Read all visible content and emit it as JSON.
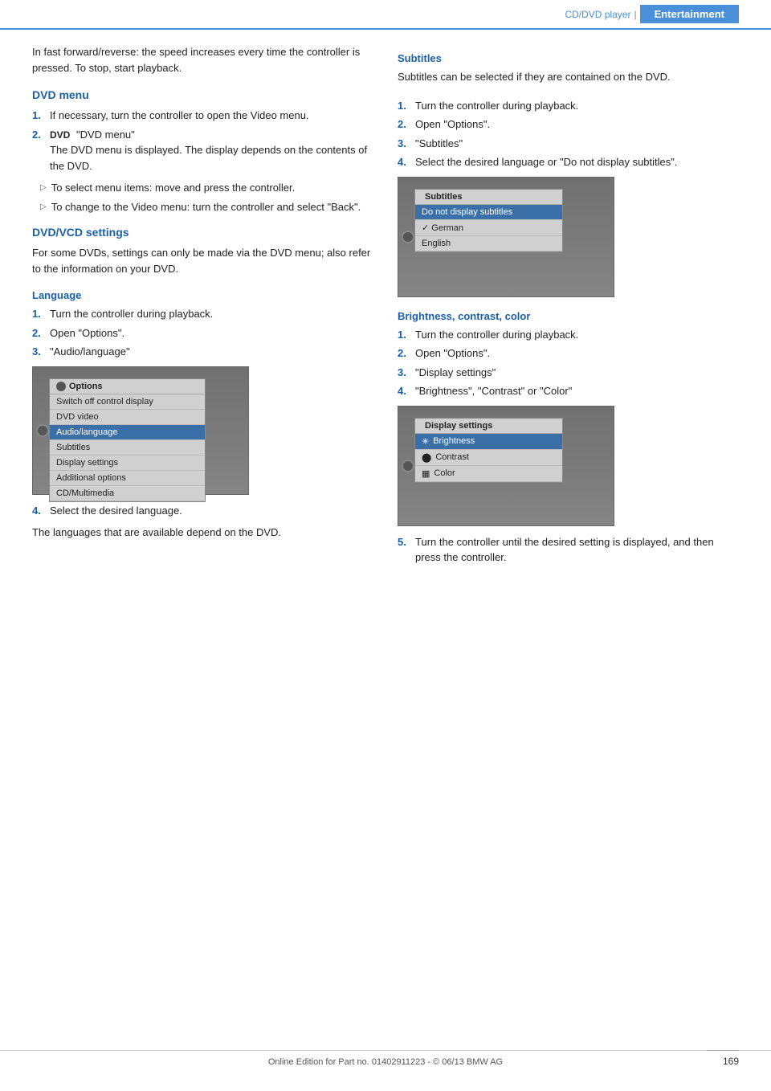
{
  "header": {
    "section_label": "CD/DVD player",
    "active_label": "Entertainment"
  },
  "intro": {
    "text": "In fast forward/reverse: the speed increases every time the controller is pressed. To stop, start playback."
  },
  "dvd_menu": {
    "heading": "DVD menu",
    "steps": [
      {
        "num": "1.",
        "text": "If necessary, turn the controller to open the Video menu."
      },
      {
        "num": "2.",
        "icon": "DVD",
        "text": "\"DVD menu\"\nThe DVD menu is displayed. The display depends on the contents of the DVD."
      }
    ],
    "bullets": [
      "To select menu items: move and press the controller.",
      "To change to the Video menu: turn the controller and select \"Back\"."
    ]
  },
  "dvd_vcd_settings": {
    "heading": "DVD/VCD settings",
    "intro": "For some DVDs, settings can only be made via the DVD menu; also refer to the information on your DVD.",
    "language": {
      "subheading": "Language",
      "steps": [
        {
          "num": "1.",
          "text": "Turn the controller during playback."
        },
        {
          "num": "2.",
          "text": "Open \"Options\"."
        },
        {
          "num": "3.",
          "text": "\"Audio/language\""
        }
      ],
      "step4": {
        "num": "4.",
        "text": "Select the desired language."
      },
      "step4_note": "The languages that are available depend on the DVD."
    },
    "options_menu": {
      "title": "Options",
      "items": [
        {
          "label": "Switch off control display",
          "highlighted": false
        },
        {
          "label": "DVD video",
          "highlighted": false
        },
        {
          "label": "Audio/language",
          "highlighted": true
        },
        {
          "label": "Subtitles",
          "highlighted": false
        },
        {
          "label": "Display settings",
          "highlighted": false
        },
        {
          "label": "Additional options",
          "highlighted": false
        },
        {
          "label": "CD/Multimedia",
          "highlighted": false
        }
      ]
    }
  },
  "subtitles": {
    "heading": "Subtitles",
    "intro": "Subtitles can be selected if they are contained on the DVD.",
    "steps": [
      {
        "num": "1.",
        "text": "Turn the controller during playback."
      },
      {
        "num": "2.",
        "text": "Open \"Options\"."
      },
      {
        "num": "3.",
        "text": "\"Subtitles\""
      },
      {
        "num": "4.",
        "text": "Select the desired language or \"Do not display subtitles\"."
      }
    ],
    "menu": {
      "title": "Subtitles",
      "items": [
        {
          "label": "Do not display subtitles",
          "selected": true
        },
        {
          "label": "✓ German",
          "selected": false
        },
        {
          "label": "English",
          "selected": false
        }
      ]
    }
  },
  "brightness_contrast_color": {
    "heading": "Brightness, contrast, color",
    "steps": [
      {
        "num": "1.",
        "text": "Turn the controller during playback."
      },
      {
        "num": "2.",
        "text": "Open \"Options\"."
      },
      {
        "num": "3.",
        "text": "\"Display settings\""
      },
      {
        "num": "4.",
        "text": "\"Brightness\", \"Contrast\" or \"Color\""
      }
    ],
    "step5": {
      "num": "5.",
      "text": "Turn the controller until the desired setting is displayed, and then press the controller."
    },
    "menu": {
      "title": "Display settings",
      "items": [
        {
          "label": "Brightness",
          "selected": true,
          "icon": "sun"
        },
        {
          "label": "Contrast",
          "selected": false,
          "icon": "circle"
        },
        {
          "label": "Color",
          "selected": false,
          "icon": "grid"
        }
      ]
    }
  },
  "footer": {
    "text": "Online Edition for Part no. 01402911223 - © 06/13 BMW AG"
  },
  "page_number": "169"
}
